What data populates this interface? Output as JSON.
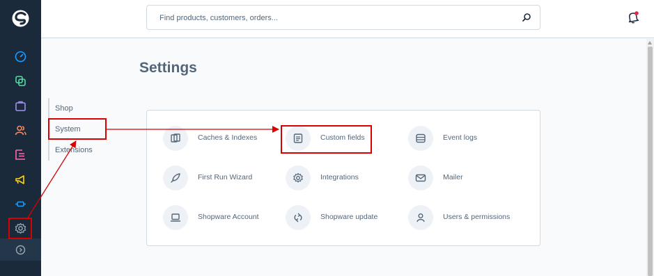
{
  "topbar": {
    "search_placeholder": "Find products, customers, orders...",
    "icons": {
      "search": "search-icon",
      "notifications": "bell-icon"
    }
  },
  "sidebar": {
    "logo": "shopware-logo",
    "items": [
      {
        "icon": "dashboard-icon",
        "color": "#189eff"
      },
      {
        "icon": "catalogue-icon",
        "color": "#57d9a3"
      },
      {
        "icon": "orders-icon",
        "color": "#a092f0"
      },
      {
        "icon": "customers-icon",
        "color": "#f88962"
      },
      {
        "icon": "content-icon",
        "color": "#ff68b4"
      },
      {
        "icon": "marketing-icon",
        "color": "#ffd700"
      },
      {
        "icon": "extensions-icon",
        "color": "#189eff"
      },
      {
        "icon": "settings-icon",
        "color": "#9aa8b5"
      },
      {
        "icon": "expand-icon",
        "color": "#9aa8b5"
      }
    ]
  },
  "page": {
    "title": "Settings"
  },
  "settings_nav": {
    "items": [
      "Shop",
      "System",
      "Extensions"
    ]
  },
  "system_settings": {
    "items": [
      {
        "label": "Caches & Indexes",
        "icon": "cache-icon"
      },
      {
        "label": "Custom fields",
        "icon": "custom-fields-icon"
      },
      {
        "label": "Event logs",
        "icon": "event-logs-icon"
      },
      {
        "label": "First Run Wizard",
        "icon": "rocket-icon"
      },
      {
        "label": "Integrations",
        "icon": "gear-icon"
      },
      {
        "label": "Mailer",
        "icon": "mail-icon"
      },
      {
        "label": "Shopware Account",
        "icon": "laptop-icon"
      },
      {
        "label": "Shopware update",
        "icon": "update-icon"
      },
      {
        "label": "Users & permissions",
        "icon": "user-icon"
      }
    ]
  },
  "annotation_color": "#d80000"
}
